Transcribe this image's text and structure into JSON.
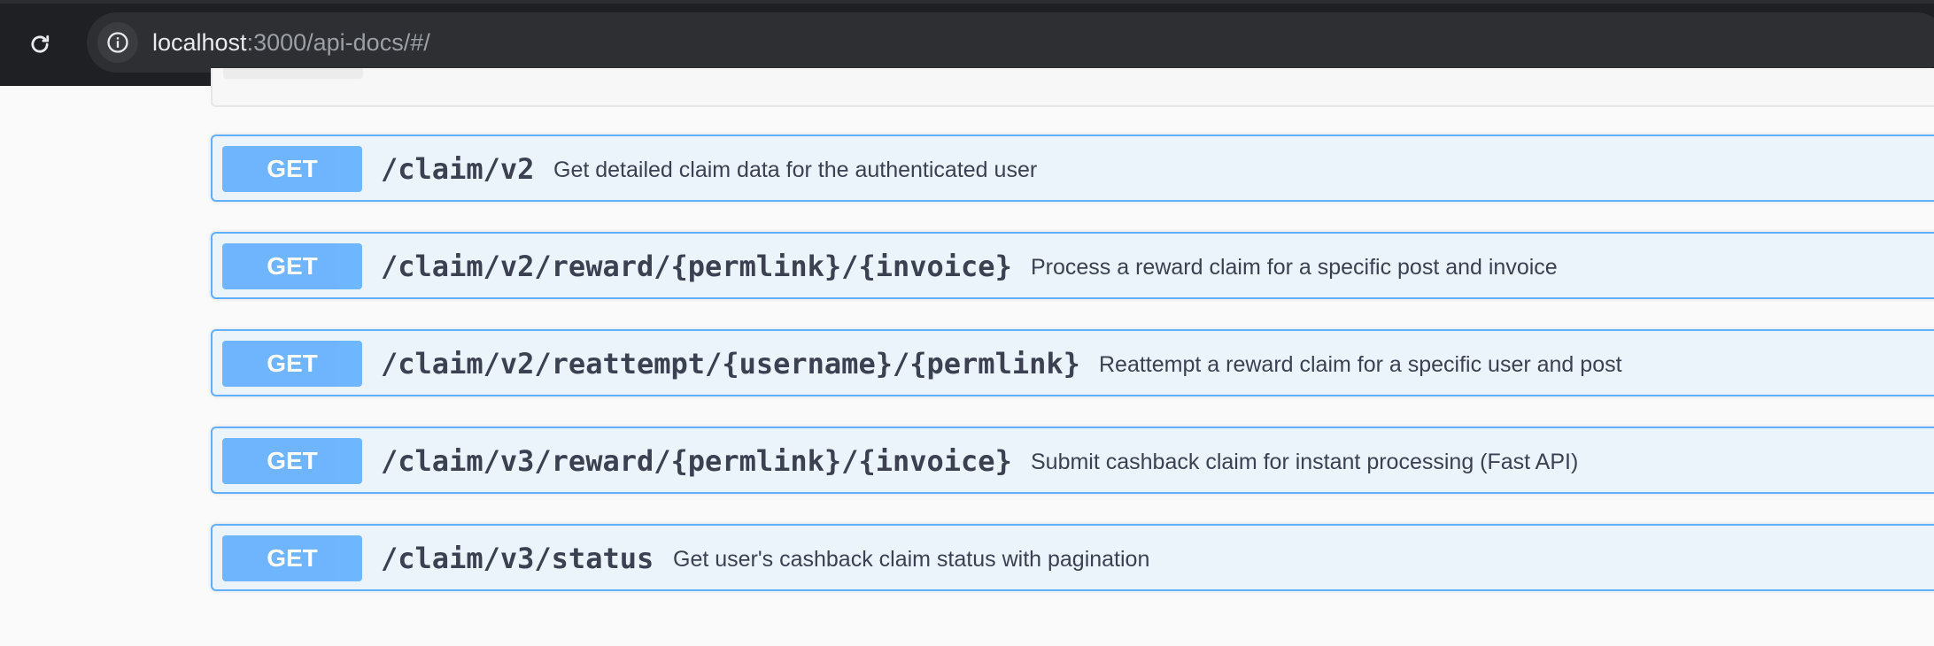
{
  "browser": {
    "url_host": "localhost",
    "url_rest": ":3000/api-docs/#/",
    "icons": {
      "reload": "reload-icon",
      "info": "info-icon"
    }
  },
  "colors": {
    "get_accent": "#61affe",
    "get_background": "#ebf3fb",
    "text": "#3b4151"
  },
  "endpoints": [
    {
      "method": "GET",
      "path": "/claim/v2",
      "description": "Get detailed claim data for the authenticated user"
    },
    {
      "method": "GET",
      "path": "/claim/v2/reward/{permlink}/{invoice}",
      "description": "Process a reward claim for a specific post and invoice"
    },
    {
      "method": "GET",
      "path": "/claim/v2/reattempt/{username}/{permlink}",
      "description": "Reattempt a reward claim for a specific user and post"
    },
    {
      "method": "GET",
      "path": "/claim/v3/reward/{permlink}/{invoice}",
      "description": "Submit cashback claim for instant processing (Fast API)"
    },
    {
      "method": "GET",
      "path": "/claim/v3/status",
      "description": "Get user's cashback claim status with pagination"
    }
  ]
}
